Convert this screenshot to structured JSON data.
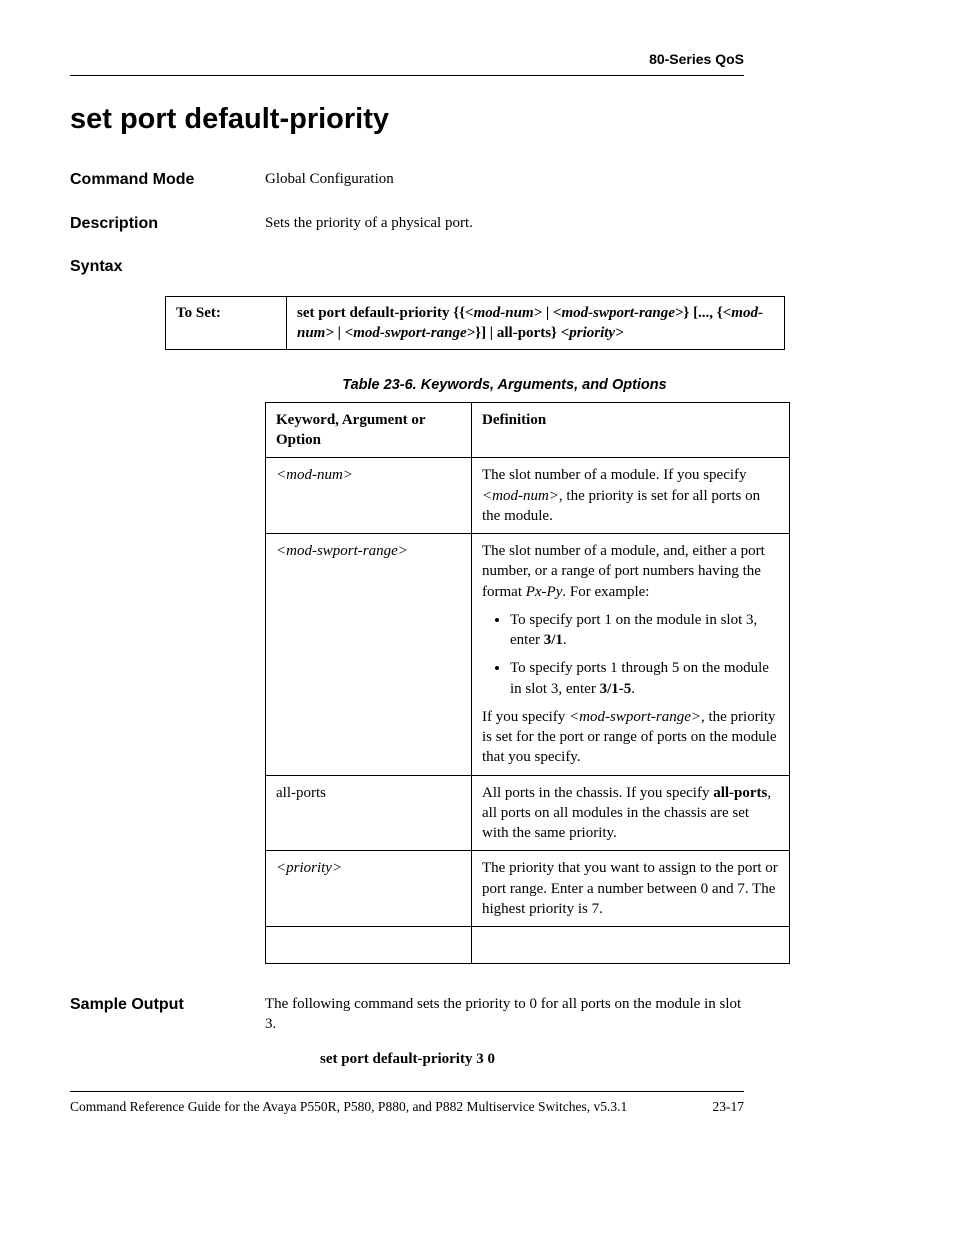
{
  "header": {
    "section": "80-Series QoS"
  },
  "title": "set port default-priority",
  "command_mode": {
    "label": "Command Mode",
    "value": "Global Configuration"
  },
  "description": {
    "label": "Description",
    "value": "Sets the priority of a physical port."
  },
  "syntax": {
    "label": "Syntax",
    "to_set_label": "To Set:",
    "to_set_value_pre": "set port default-priority {{",
    "to_set_arg1": "<mod-num>",
    "to_set_sep1": " | ",
    "to_set_arg2": "<mod-swport-range>",
    "to_set_post1": "} [..., {",
    "to_set_arg3": "<mod-num>",
    "to_set_sep2": " | ",
    "to_set_arg4": "<mod-swport-range>",
    "to_set_post2": "}] | all-ports} ",
    "to_set_arg5": "<priority>"
  },
  "table_caption": "Table 23-6.  Keywords, Arguments, and Options",
  "args_table": {
    "head_key": "Keyword, Argument or Option",
    "head_def": "Definition",
    "rows": [
      {
        "key": "<mod-num>",
        "def_pre": "The slot number of a module. If you specify ",
        "def_ital": "<mod-num>",
        "def_post": ", the priority is set for all ports on the module."
      },
      {
        "key": "<mod-swport-range>",
        "def_p1_pre": "The slot number of a module, and, either a port number, or a range of port numbers having the format ",
        "def_p1_ital": "Px-Py",
        "def_p1_post": ". For example:",
        "b1_pre": "To specify port 1 on the module in slot 3, enter ",
        "b1_bold": "3/1",
        "b1_post": ".",
        "b2_pre": "To specify ports 1 through 5 on the module in slot 3, enter ",
        "b2_bold": "3/1-5",
        "b2_post": ".",
        "def_p2_pre": "If you specify ",
        "def_p2_ital": "<mod-swport-range>",
        "def_p2_post": ", the priority is set for the port or range of ports on the module that you specify."
      },
      {
        "key": "all-ports",
        "def_pre": "All ports in the chassis. If you specify ",
        "def_bold": "all-ports",
        "def_post": ", all ports on all modules in the chassis are set with the same priority."
      },
      {
        "key": "<priority>",
        "def": "The priority that you want to assign to the port or port range. Enter a number between 0 and 7. The highest priority is 7."
      }
    ]
  },
  "sample_output": {
    "label": "Sample Output",
    "text": "The following command sets the priority to 0 for all ports on the module in slot 3.",
    "command": "set port default-priority 3 0"
  },
  "footer": {
    "left": "Command Reference Guide for the Avaya P550R, P580, P880, and P882 Multiservice Switches, v5.3.1",
    "right": "23-17"
  }
}
